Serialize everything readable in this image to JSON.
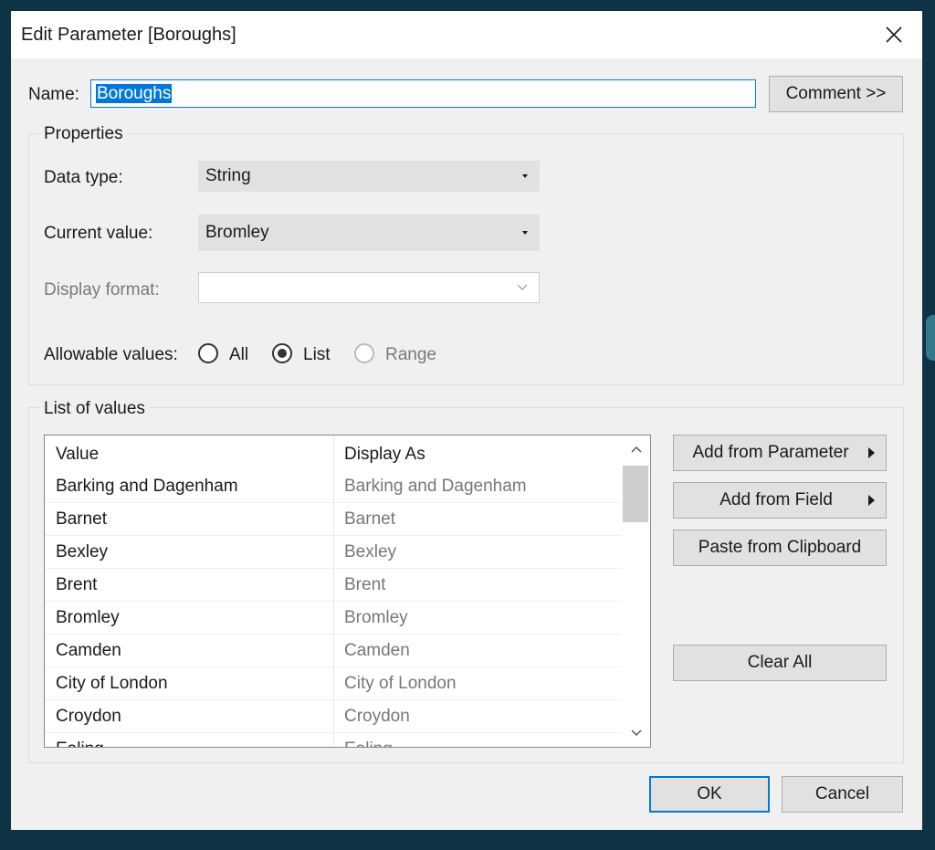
{
  "dialog": {
    "title": "Edit Parameter [Boroughs]",
    "close_icon": "close-icon"
  },
  "name": {
    "label": "Name:",
    "value": "Boroughs",
    "comment_button": "Comment >>"
  },
  "properties": {
    "group_title": "Properties",
    "data_type": {
      "label": "Data type:",
      "value": "String"
    },
    "current_value": {
      "label": "Current value:",
      "value": "Bromley"
    },
    "display_format": {
      "label": "Display format:",
      "value": ""
    },
    "allowable_values": {
      "label": "Allowable values:",
      "options": [
        "All",
        "List",
        "Range"
      ],
      "selected": "List"
    }
  },
  "list_of_values": {
    "group_title": "List of values",
    "columns": [
      "Value",
      "Display As"
    ],
    "rows": [
      {
        "value": "Barking and Dagenham",
        "display": "Barking and Dagenham"
      },
      {
        "value": "Barnet",
        "display": "Barnet"
      },
      {
        "value": "Bexley",
        "display": "Bexley"
      },
      {
        "value": "Brent",
        "display": "Brent"
      },
      {
        "value": "Bromley",
        "display": "Bromley"
      },
      {
        "value": "Camden",
        "display": "Camden"
      },
      {
        "value": "City of London",
        "display": "City of London"
      },
      {
        "value": "Croydon",
        "display": "Croydon"
      },
      {
        "value": "Ealing",
        "display": "Ealing"
      }
    ],
    "buttons": {
      "add_from_parameter": "Add from Parameter",
      "add_from_field": "Add from Field",
      "paste_from_clipboard": "Paste from Clipboard",
      "clear_all": "Clear All"
    }
  },
  "footer": {
    "ok": "OK",
    "cancel": "Cancel"
  },
  "colors": {
    "accent": "#0078d7",
    "dialog_bg": "#f0f0f0",
    "desktop_bg": "#0d3344"
  }
}
